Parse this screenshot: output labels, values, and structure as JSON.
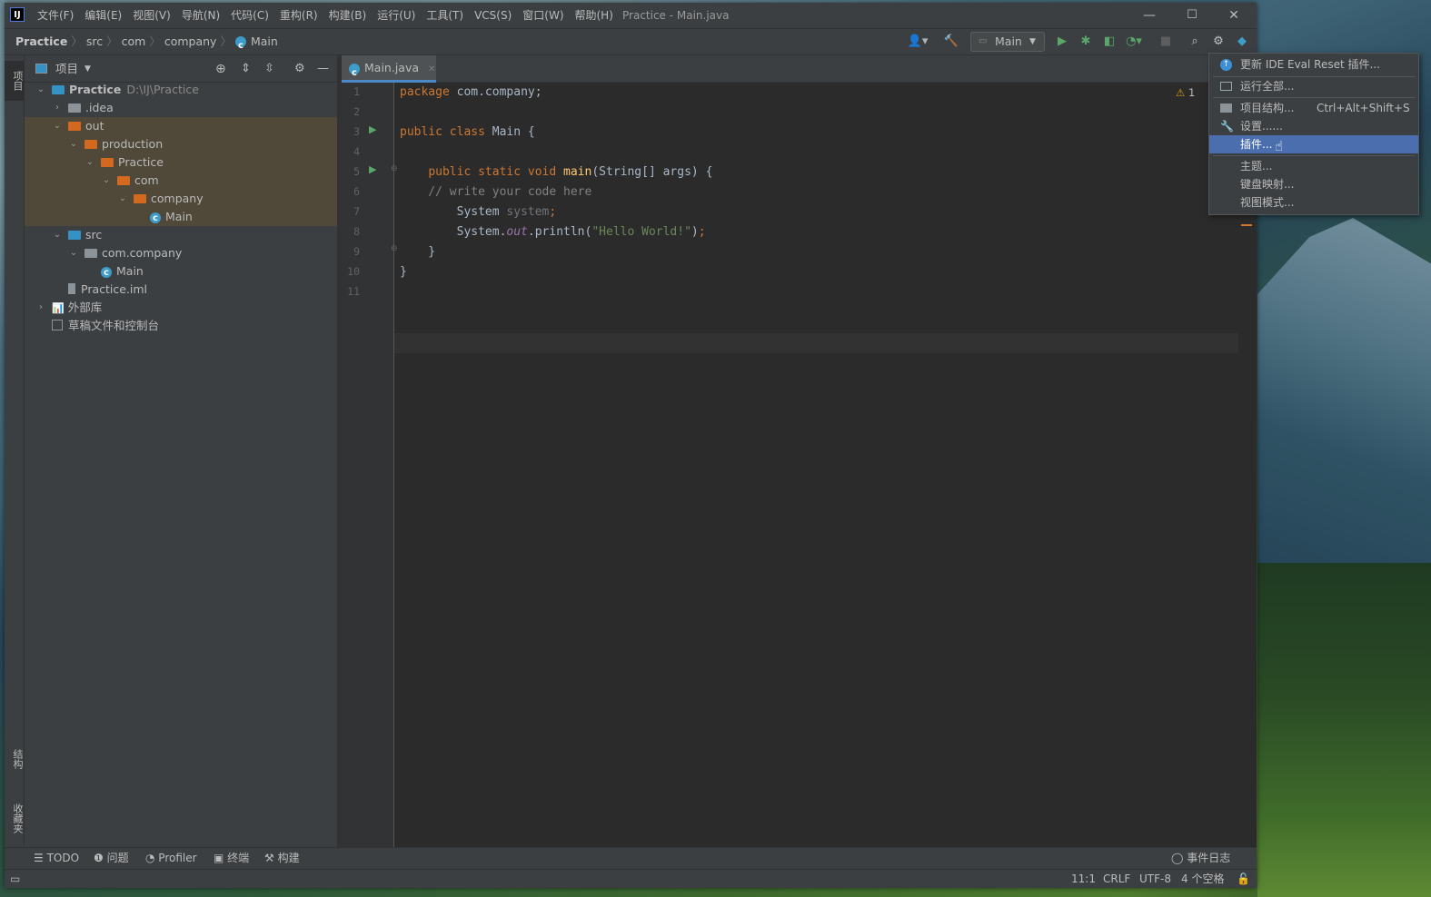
{
  "window": {
    "app_logo": "IJ",
    "title": "Practice - Main.java",
    "controls": [
      "—",
      "☐",
      "✕"
    ]
  },
  "menu": [
    "文件(F)",
    "编辑(E)",
    "视图(V)",
    "导航(N)",
    "代码(C)",
    "重构(R)",
    "构建(B)",
    "运行(U)",
    "工具(T)",
    "VCS(S)",
    "窗口(W)",
    "帮助(H)"
  ],
  "breadcrumb": [
    "Practice",
    "src",
    "com",
    "company",
    "Main"
  ],
  "toolbar": {
    "run_config": "Main"
  },
  "left_strip": {
    "project_tab": "项目",
    "structure_tab": "结构",
    "favorites_tab": "收藏夹"
  },
  "project_panel": {
    "title": "项目",
    "tree": [
      {
        "label": "Practice",
        "sub": "D:\\IJ\\Practice",
        "level": 0,
        "expanded": true,
        "icon": "module-folder"
      },
      {
        "label": ".idea",
        "level": 1,
        "expanded": false,
        "icon": "folder-grey"
      },
      {
        "label": "out",
        "level": 1,
        "expanded": true,
        "icon": "folder-orange"
      },
      {
        "label": "production",
        "level": 2,
        "expanded": true,
        "icon": "folder-orange"
      },
      {
        "label": "Practice",
        "level": 3,
        "expanded": true,
        "icon": "folder-orange"
      },
      {
        "label": "com",
        "level": 4,
        "expanded": true,
        "icon": "folder-orange"
      },
      {
        "label": "company",
        "level": 5,
        "expanded": true,
        "icon": "folder-orange"
      },
      {
        "label": "Main",
        "level": 6,
        "icon": "class"
      },
      {
        "label": "src",
        "level": 1,
        "expanded": true,
        "icon": "folder-blue"
      },
      {
        "label": "com.company",
        "level": 2,
        "expanded": true,
        "icon": "package"
      },
      {
        "label": "Main",
        "level": 3,
        "icon": "class"
      },
      {
        "label": "Practice.iml",
        "level": 1,
        "icon": "iml-file"
      },
      {
        "label": "外部库",
        "level": 0,
        "expanded": false,
        "icon": "library"
      },
      {
        "label": "草稿文件和控制台",
        "level": 0,
        "icon": "scratch"
      }
    ]
  },
  "editor": {
    "tab": "Main.java",
    "inspection_count": "1",
    "line_numbers": [
      "1",
      "2",
      "3",
      "4",
      "5",
      "6",
      "7",
      "8",
      "9",
      "10",
      "11"
    ]
  },
  "popup_menu": {
    "items": [
      {
        "label": "更新 IDE Eval Reset 插件...",
        "icon": "update-icon"
      },
      {
        "label": "运行全部...",
        "icon": "run-all-icon"
      },
      {
        "label": "项目结构...",
        "shortcut": "Ctrl+Alt+Shift+S",
        "icon": "project-structure-icon"
      },
      {
        "label": "设置......",
        "icon": "wrench-icon"
      },
      {
        "label": "插件...",
        "selected": true
      },
      {
        "label": "主题..."
      },
      {
        "label": "键盘映射..."
      },
      {
        "label": "视图模式..."
      }
    ]
  },
  "bottom_tools": [
    "TODO",
    "问题",
    "Profiler",
    "终端",
    "构建"
  ],
  "event_log": "事件日志",
  "status": {
    "position": "11:1",
    "line_sep": "CRLF",
    "encoding": "UTF-8",
    "indent": "4 个空格"
  },
  "colors": {
    "selection": "#4b6eaf",
    "tab_underline": "#4a88c7",
    "keyword": "#cc7832",
    "function": "#ffc66d",
    "string": "#6a8759"
  }
}
